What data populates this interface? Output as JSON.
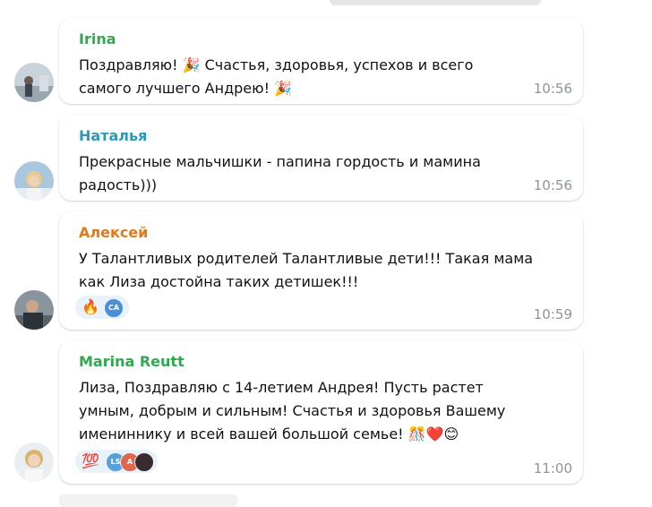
{
  "messages": [
    {
      "sender": "Irina",
      "sender_color": "#2fa84f",
      "line1": "Поздравляю! 🎉 Счастья, здоровья, успехов и всего",
      "line2": "самого лучшего Андрею! 🎉",
      "time": "10:56"
    },
    {
      "sender": "Наталья",
      "sender_color": "#2b9ab8",
      "line1": "Прекрасные мальчишки - папина гордость и мамина",
      "line2": "радость)))",
      "time": "10:56"
    },
    {
      "sender": "Алексей",
      "sender_color": "#e07a1f",
      "line1": "У Талантливых родителей Талантливые дети!!! Такая мама",
      "line2": "как Лиза достойна таких детишек!!!",
      "time": "10:59",
      "reactions": {
        "emoji": "🔥",
        "avatar_initials": "CA"
      }
    },
    {
      "sender": "Marina Reutt",
      "sender_color": "#2fa84f",
      "line1": "Лиза, Поздравляю с 14-летием Андрея! Пусть растет",
      "line2": "умным, добрым и сильным! Счастья и здоровья Вашему",
      "line3": "имениннику и всей вашей большой семье! 🎊❤️😊",
      "time": "11:00",
      "reactions": {
        "emoji": "💯",
        "avatar_initials": "LS",
        "avatar2_initials": "А"
      }
    }
  ]
}
